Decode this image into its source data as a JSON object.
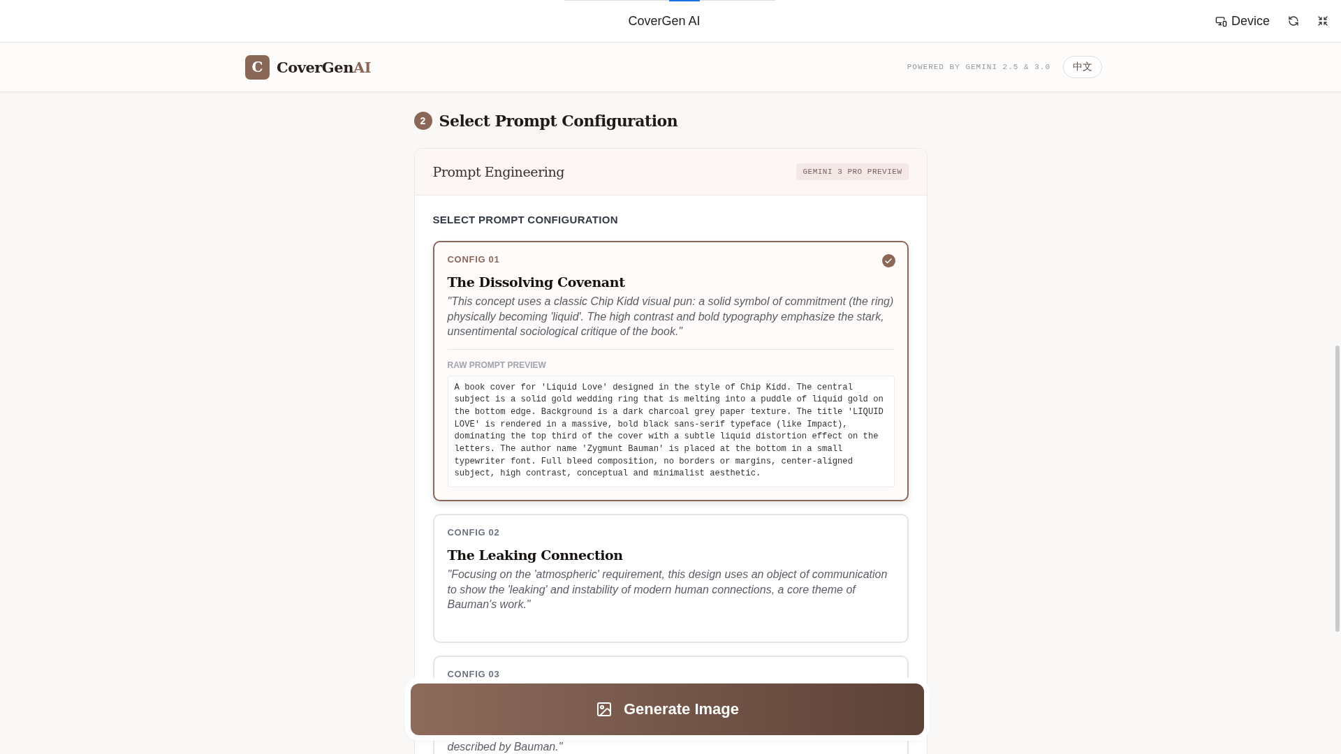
{
  "topbar": {
    "title": "CoverGen AI",
    "device_label": "Device"
  },
  "header": {
    "logo_letter": "C",
    "brand": "CoverGen",
    "brand_accent": "AI",
    "powered_by": "POWERED BY GEMINI 2.5 & 3.0",
    "language": "中文"
  },
  "step": {
    "number": "2",
    "title": "Select Prompt Configuration"
  },
  "panel": {
    "title": "Prompt Engineering",
    "badge": "GEMINI 3 PRO PREVIEW",
    "section_label": "SELECT PROMPT CONFIGURATION"
  },
  "configs": [
    {
      "label": "CONFIG 01",
      "title": "The Dissolving Covenant",
      "description": "\"This concept uses a classic Chip Kidd visual pun: a solid symbol of commitment (the ring) physically becoming 'liquid'. The high contrast and bold typography emphasize the stark, unsentimental sociological critique of the book.\"",
      "selected": true,
      "raw_label": "RAW PROMPT PREVIEW",
      "raw_prompt": "A book cover for 'Liquid Love' designed in the style of Chip Kidd. The central subject is a solid gold wedding ring that is melting into a puddle of liquid gold on the bottom edge. Background is a dark charcoal grey paper texture. The title 'LIQUID LOVE' is rendered in a massive, bold black sans-serif typeface (like Impact), dominating the top third of the cover with a subtle liquid distortion effect on the letters. The author name 'Zygmunt Bauman' is placed at the bottom in a small typewriter font. Full bleed composition, no borders or margins, center-aligned subject, high contrast, conceptual and minimalist aesthetic."
    },
    {
      "label": "CONFIG 02",
      "title": "The Leaking Connection",
      "description": "\"Focusing on the 'atmospheric' requirement, this design uses an object of communication to show the 'leaking' and instability of modern human connections, a core theme of Bauman's work.\"",
      "selected": false
    },
    {
      "label": "CONFIG 03",
      "description": "described by Bauman.\"",
      "selected": false
    }
  ],
  "generate_button": "Generate Image"
}
